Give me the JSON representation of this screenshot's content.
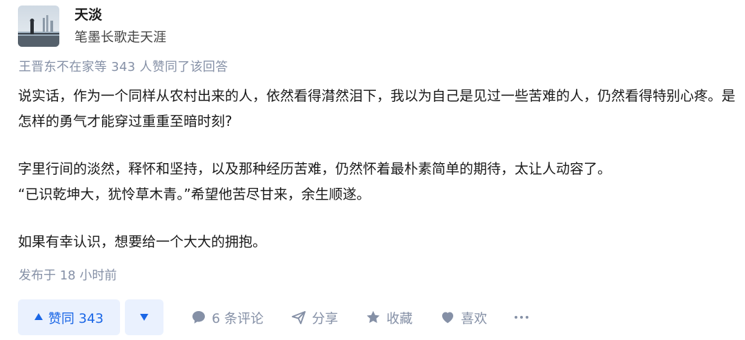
{
  "author": {
    "name": "天淡",
    "headline": "笔墨长歌走天涯"
  },
  "vote_notice": "王晋东不在家等 343 人赞同了该回答",
  "answer": {
    "paragraphs": [
      "说实话，作为一个同样从农村出来的人，依然看得潸然泪下，我以为自己是见过一些苦难的人，仍然看得特别心疼。是怎样的勇气才能穿过重重至暗时刻?",
      "字里行间的淡然，释怀和坚持，以及那种经历苦难，仍然怀着最朴素简单的期待，太让人动容了。\n“已识乾坤大，犹怜草木青。”希望他苦尽甘来，余生顺遂。",
      "如果有幸认识，想要给一个大大的拥抱。"
    ],
    "published": "发布于 18 小时前"
  },
  "actions": {
    "upvote_label": "赞同 343",
    "comment_label": "6 条评论",
    "share_label": "分享",
    "favorite_label": "收藏",
    "like_label": "喜欢"
  },
  "colors": {
    "accent": "#1a66e6",
    "accent_bg": "#eaf1fe",
    "muted": "#8590a6"
  }
}
